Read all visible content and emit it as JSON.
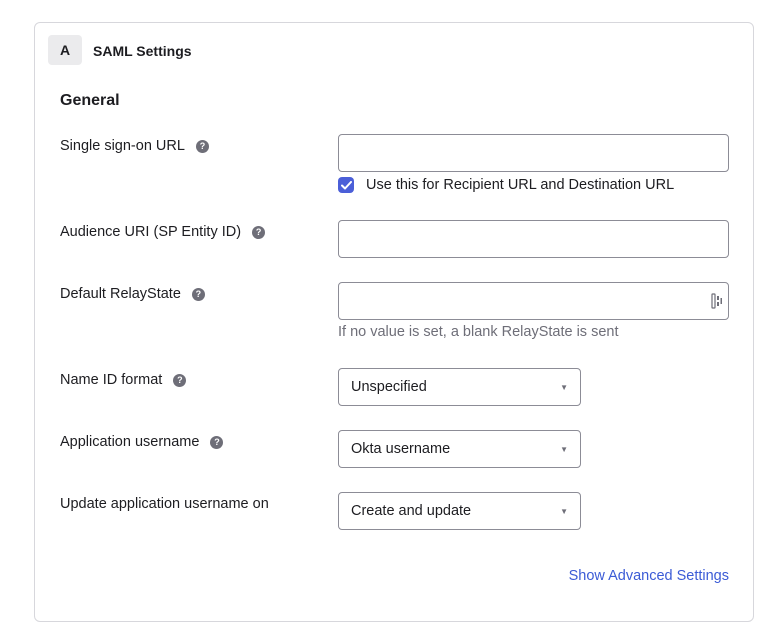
{
  "section": {
    "step": "A",
    "title": "SAML Settings"
  },
  "general": {
    "title": "General",
    "sso_url": {
      "label": "Single sign-on URL",
      "value": "",
      "checkbox_label": "Use this for Recipient URL and Destination URL",
      "checkbox_checked": true
    },
    "audience_uri": {
      "label": "Audience URI (SP Entity ID)",
      "value": ""
    },
    "relay_state": {
      "label": "Default RelayState",
      "value": "",
      "hint": "If no value is set, a blank RelayState is sent"
    },
    "name_id_format": {
      "label": "Name ID format",
      "selected": "Unspecified"
    },
    "app_username": {
      "label": "Application username",
      "selected": "Okta username"
    },
    "update_username_on": {
      "label": "Update application username on",
      "selected": "Create and update"
    }
  },
  "advanced_link": "Show Advanced Settings",
  "help_glyph": "?",
  "caret_glyph": "▼",
  "colors": {
    "accent": "#4b5fd8",
    "link": "#3b5bd6",
    "border": "#8c8c96",
    "card_border": "#d7d7dc",
    "hint_text": "#6e6e78"
  },
  "icons": {
    "help": "question-circle-icon",
    "checkbox": "checkmark-icon",
    "password_manager": "password-manager-icon",
    "select": "chevron-down-icon"
  }
}
